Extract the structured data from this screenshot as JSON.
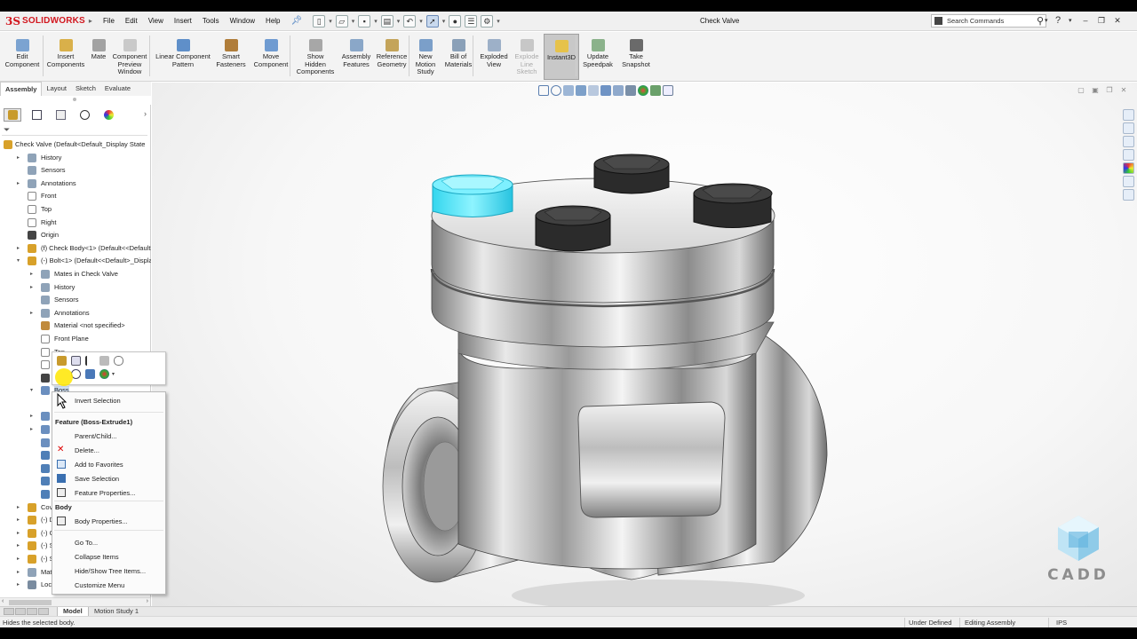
{
  "app": {
    "logo_ds": "3S",
    "logo_name": "SOLIDWORKS",
    "document_title": "Check Valve"
  },
  "menu": [
    "File",
    "Edit",
    "View",
    "Insert",
    "Tools",
    "Window",
    "Help"
  ],
  "search": {
    "label": "Search Commands"
  },
  "ribbon": [
    {
      "id": "edit-component",
      "label": "Edit\nComponent"
    },
    {
      "id": "insert-components",
      "label": "Insert\nComponents"
    },
    {
      "id": "mate",
      "label": "Mate"
    },
    {
      "id": "component-preview",
      "label": "Component\nPreview\nWindow"
    },
    {
      "id": "linear-pattern",
      "label": "Linear Component\nPattern"
    },
    {
      "id": "smart-fasteners",
      "label": "Smart\nFasteners"
    },
    {
      "id": "move-component",
      "label": "Move\nComponent"
    },
    {
      "id": "show-hidden",
      "label": "Show\nHidden\nComponents"
    },
    {
      "id": "assembly-features",
      "label": "Assembly\nFeatures"
    },
    {
      "id": "reference-geometry",
      "label": "Reference\nGeometry"
    },
    {
      "id": "new-motion-study",
      "label": "New\nMotion\nStudy"
    },
    {
      "id": "bill-of-materials",
      "label": "Bill of\nMaterials"
    },
    {
      "id": "exploded-view",
      "label": "Exploded\nView"
    },
    {
      "id": "explode-line-sketch",
      "label": "Explode\nLine\nSketch"
    },
    {
      "id": "instant3d",
      "label": "Instant3D"
    },
    {
      "id": "update-speedpak",
      "label": "Update\nSpeedpak"
    },
    {
      "id": "take-snapshot",
      "label": "Take\nSnapshot"
    }
  ],
  "command_tabs": [
    "Assembly",
    "Layout",
    "Sketch",
    "Evaluate"
  ],
  "tree": [
    {
      "label": "Check Valve  (Default<Default_Display State"
    },
    {
      "label": "History"
    },
    {
      "label": "Sensors"
    },
    {
      "label": "Annotations"
    },
    {
      "label": "Front"
    },
    {
      "label": "Top"
    },
    {
      "label": "Right"
    },
    {
      "label": "Origin"
    },
    {
      "label": "(f) Check Body<1> (Default<<Default>_"
    },
    {
      "label": "(-) Bolt<1> (Default<<Default>_Display"
    },
    {
      "label": "Mates in Check Valve"
    },
    {
      "label": "History"
    },
    {
      "label": "Sensors"
    },
    {
      "label": "Annotations"
    },
    {
      "label": "Material <not specified>"
    },
    {
      "label": "Front Plane"
    },
    {
      "label": "Top"
    },
    {
      "label": "Rig"
    },
    {
      "label": "Ori"
    },
    {
      "label": "Boss"
    },
    {
      "label": ""
    },
    {
      "label": "Bos"
    },
    {
      "label": "Bos"
    },
    {
      "label": "Ch"
    },
    {
      "label": "Cu"
    },
    {
      "label": "He"
    },
    {
      "label": "Cu"
    },
    {
      "label": "Cu"
    },
    {
      "label": "Cover<"
    },
    {
      "label": "(-) Disc"
    },
    {
      "label": "(-) Gask"
    },
    {
      "label": "(-) Seat"
    },
    {
      "label": "(-) Sprir"
    },
    {
      "label": "Mates"
    },
    {
      "label": "LocalCo"
    }
  ],
  "context_menu": {
    "invert_selection": "Invert Selection",
    "feature_header": "Feature (Boss-Extrude1)",
    "parent_child": "Parent/Child...",
    "delete": "Delete...",
    "add_to_favorites": "Add to Favorites",
    "save_selection": "Save Selection",
    "feature_properties": "Feature Properties...",
    "body_header": "Body",
    "body_properties": "Body Properties...",
    "go_to": "Go To...",
    "collapse_items": "Collapse Items",
    "hide_show_tree": "Hide/Show Tree Items...",
    "customize_menu": "Customize Menu"
  },
  "bottom_tabs": [
    "Model",
    "Motion Study 1"
  ],
  "status": {
    "message": "Hides the selected body.",
    "state": "Under Defined",
    "mode": "Editing Assembly",
    "units": "IPS"
  },
  "watermark": "CADD",
  "colors": {
    "accent_red": "#d2171f",
    "selection_cyan": "#2fe0f5",
    "bolt_black": "#2a2a2a",
    "assembly_yellow": "#d8a12a"
  }
}
